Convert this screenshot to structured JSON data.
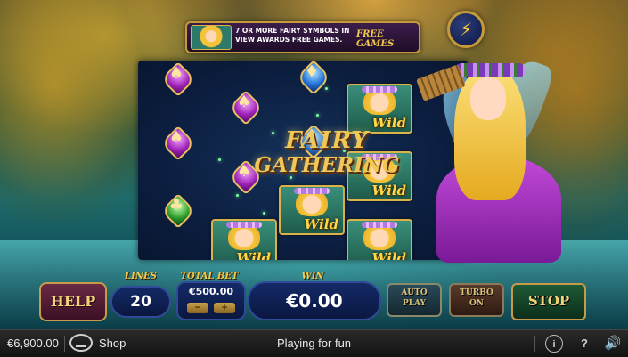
{
  "banner": {
    "text": "7 OR MORE FAIRY SYMBOLS IN VIEW AWARDS FREE GAMES.",
    "free_label": "FREE GAMES"
  },
  "logo": {
    "line1": "FAIRY",
    "line2": "GATHERING"
  },
  "reels": {
    "wild_label": "Wild"
  },
  "controls": {
    "help_label": "HELP",
    "lines_label": "LINES",
    "lines_value": "20",
    "total_bet_label": "TOTAL BET",
    "total_bet_value": "€500.00",
    "bet_minus": "−",
    "bet_plus": "+",
    "win_label": "WIN",
    "win_value": "€0.00",
    "auto_play_l1": "AUTO",
    "auto_play_l2": "PLAY",
    "turbo_l1": "TURBO",
    "turbo_l2": "ON",
    "stop_label": "STOP"
  },
  "bottom_bar": {
    "balance": "€6,900.00",
    "shop_label": "Shop",
    "status": "Playing for fun",
    "info_icon": "info-icon",
    "help_icon": "help-icon",
    "sound_icon": "speaker-icon"
  },
  "colors": {
    "accent_gold": "#f2c84a",
    "reel_bg": "#0b1c3c",
    "bar_bg": "#1a1a1a"
  }
}
